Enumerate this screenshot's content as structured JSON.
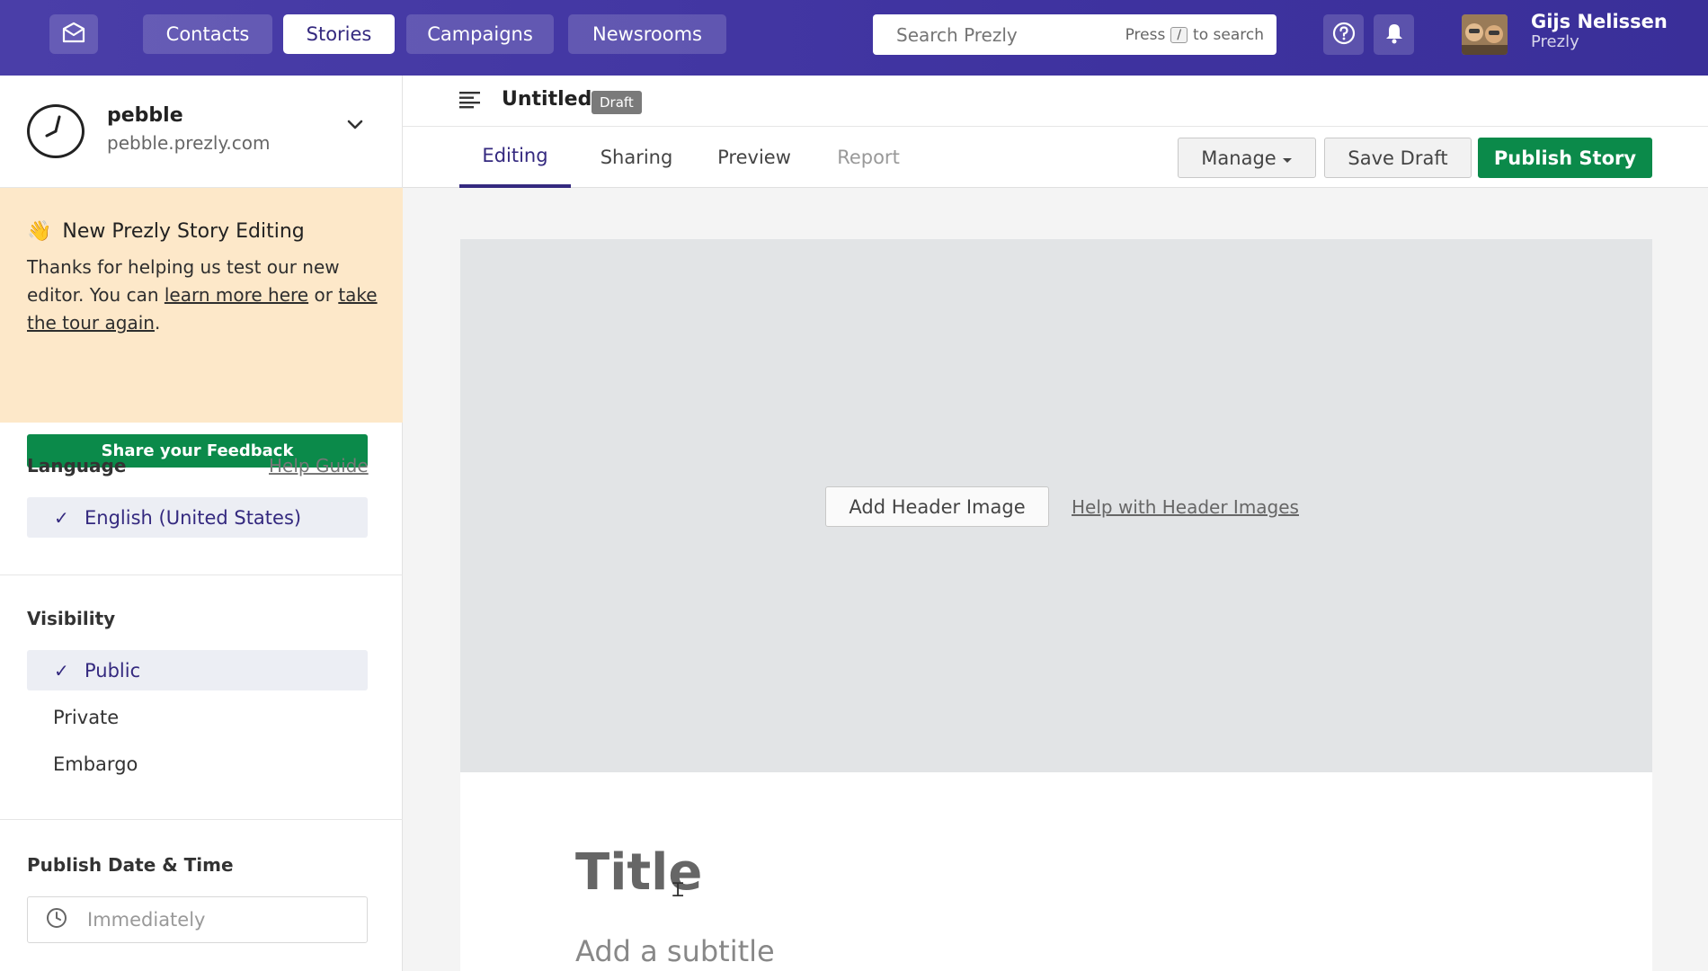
{
  "topbar": {
    "nav": [
      {
        "label": "Contacts"
      },
      {
        "label": "Stories"
      },
      {
        "label": "Campaigns"
      },
      {
        "label": "Newsrooms"
      }
    ],
    "search": {
      "placeholder": "Search Prezly",
      "hint_press": "Press",
      "hint_key": "/",
      "hint_suffix": "to search"
    },
    "user": {
      "name": "Gijs Nelissen",
      "org": "Prezly"
    }
  },
  "sidebar": {
    "newsroom": {
      "name": "pebble",
      "url": "pebble.prezly.com"
    },
    "promo": {
      "emoji": "👋",
      "title": "New Prezly Story Editing",
      "text_1": "Thanks for helping us test our new editor. You can",
      "link_1": "learn more here",
      "text_2": "or",
      "link_2": "take the tour again",
      "text_3": ".",
      "button": "Share your Feedback"
    },
    "language": {
      "label": "Language",
      "help": "Help Guide",
      "selected": "English (United States)"
    },
    "visibility": {
      "label": "Visibility",
      "options": [
        "Public",
        "Private",
        "Embargo"
      ]
    },
    "publish": {
      "label": "Publish Date & Time",
      "value": "Immediately"
    }
  },
  "header": {
    "title": "Untitled",
    "badge": "Draft"
  },
  "tabs": [
    {
      "label": "Editing"
    },
    {
      "label": "Sharing"
    },
    {
      "label": "Preview"
    },
    {
      "label": "Report"
    }
  ],
  "actions": {
    "manage": "Manage",
    "save": "Save Draft",
    "publish": "Publish Story"
  },
  "editor": {
    "add_header": "Add Header Image",
    "help_header": "Help with Header Images",
    "title_placeholder": "Title",
    "subtitle_placeholder": "Add a subtitle"
  },
  "colors": {
    "brand": "#3f33a0",
    "primary_action": "#0b8a4a",
    "promo_bg": "#fde8c9"
  },
  "icons": [
    "prezly-logo-icon",
    "help-circle-icon",
    "bell-icon",
    "chevron-down-icon",
    "menu-lines-icon",
    "clock-icon",
    "check-icon",
    "text-cursor-icon"
  ]
}
